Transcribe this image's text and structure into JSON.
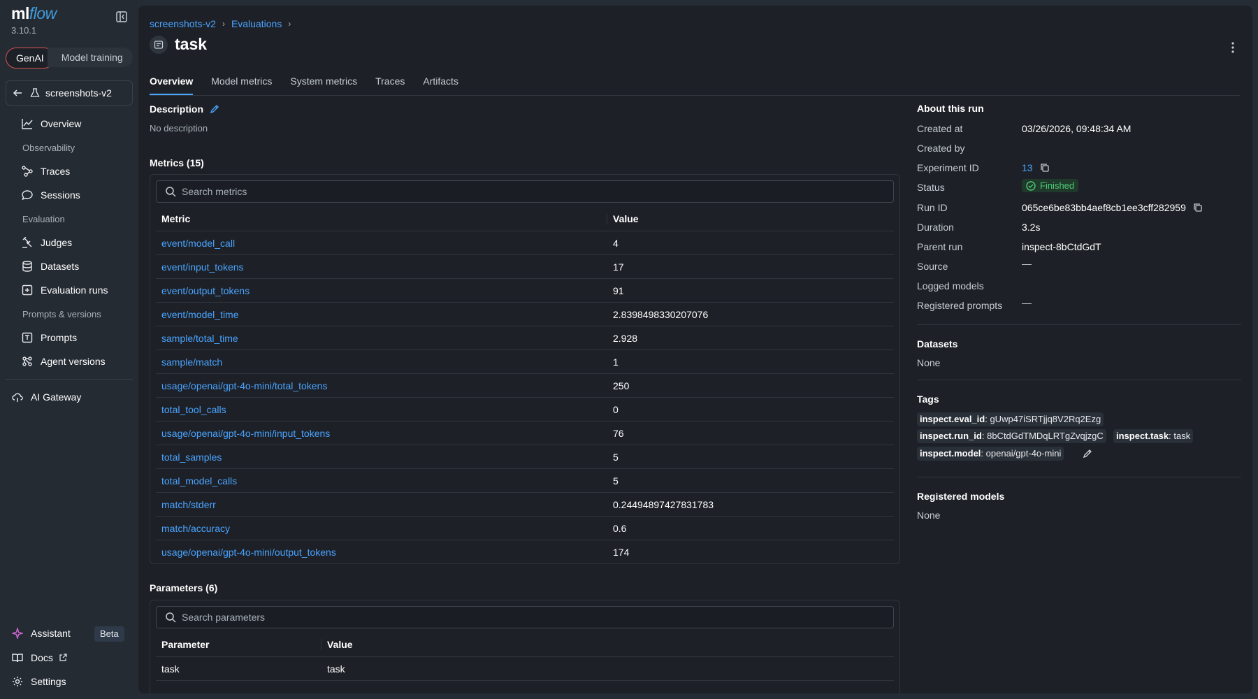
{
  "app": {
    "logo_main": "ml",
    "logo_accent": "flow",
    "version": "3.10.1"
  },
  "mode_switch": {
    "active": "GenAI",
    "inactive": "Model training"
  },
  "experiment": {
    "name": "screenshots-v2"
  },
  "sidebar": {
    "overview": "Overview",
    "observability_label": "Observability",
    "traces": "Traces",
    "sessions": "Sessions",
    "evaluation_label": "Evaluation",
    "judges": "Judges",
    "datasets": "Datasets",
    "evaluation_runs": "Evaluation runs",
    "prompts_label": "Prompts & versions",
    "prompts": "Prompts",
    "agent_versions": "Agent versions",
    "ai_gateway": "AI Gateway",
    "assistant": "Assistant",
    "beta": "Beta",
    "docs": "Docs",
    "settings": "Settings"
  },
  "breadcrumb": {
    "item1": "screenshots-v2",
    "item2": "Evaluations",
    "sep": "›"
  },
  "page": {
    "title": "task"
  },
  "tabs": [
    "Overview",
    "Model metrics",
    "System metrics",
    "Traces",
    "Artifacts"
  ],
  "description": {
    "label": "Description",
    "value": "No description"
  },
  "metrics": {
    "title": "Metrics (15)",
    "search_placeholder": "Search metrics",
    "col_metric": "Metric",
    "col_value": "Value",
    "rows": [
      [
        "event/model_call",
        "4"
      ],
      [
        "event/input_tokens",
        "17"
      ],
      [
        "event/output_tokens",
        "91"
      ],
      [
        "event/model_time",
        "2.8398498330207076"
      ],
      [
        "sample/total_time",
        "2.928"
      ],
      [
        "sample/match",
        "1"
      ],
      [
        "usage/openai/gpt-4o-mini/total_tokens",
        "250"
      ],
      [
        "total_tool_calls",
        "0"
      ],
      [
        "usage/openai/gpt-4o-mini/input_tokens",
        "76"
      ],
      [
        "total_samples",
        "5"
      ],
      [
        "total_model_calls",
        "5"
      ],
      [
        "match/stderr",
        "0.24494897427831783"
      ],
      [
        "match/accuracy",
        "0.6"
      ],
      [
        "usage/openai/gpt-4o-mini/output_tokens",
        "174"
      ]
    ]
  },
  "parameters": {
    "title": "Parameters (6)",
    "search_placeholder": "Search parameters",
    "col_param": "Parameter",
    "col_value": "Value",
    "rows": [
      [
        "task",
        "task"
      ]
    ]
  },
  "about": {
    "title": "About this run",
    "created_at_label": "Created at",
    "created_at": "03/26/2026, 09:48:34 AM",
    "created_by_label": "Created by",
    "experiment_id_label": "Experiment ID",
    "experiment_id": "13",
    "status_label": "Status",
    "status": "Finished",
    "run_id_label": "Run ID",
    "run_id": "065ce6be83bb4aef8cb1ee3cff282959",
    "duration_label": "Duration",
    "duration": "3.2s",
    "parent_run_label": "Parent run",
    "parent_run": "inspect-8bCtdGdT",
    "source_label": "Source",
    "source": "—",
    "logged_models_label": "Logged models",
    "registered_prompts_label": "Registered prompts",
    "registered_prompts": "—"
  },
  "datasets_section": {
    "title": "Datasets",
    "value": "None"
  },
  "tags": {
    "title": "Tags",
    "items": [
      {
        "key": "inspect.eval_id",
        "value": "gUwp47iSRTjjq8V2Rq2Ezg"
      },
      {
        "key": "inspect.run_id",
        "value": "8bCtdGdTMDqLRTgZvqjzgC"
      },
      {
        "key": "inspect.task",
        "value": "task"
      },
      {
        "key": "inspect.model",
        "value": "openai/gpt-4o-mini"
      }
    ]
  },
  "registered_models": {
    "title": "Registered models",
    "value": "None"
  },
  "colors": {
    "accent": "#4aa3ff",
    "success": "#4fc978",
    "brand": "#3f9ddc",
    "active_outline": "#d9534f"
  }
}
